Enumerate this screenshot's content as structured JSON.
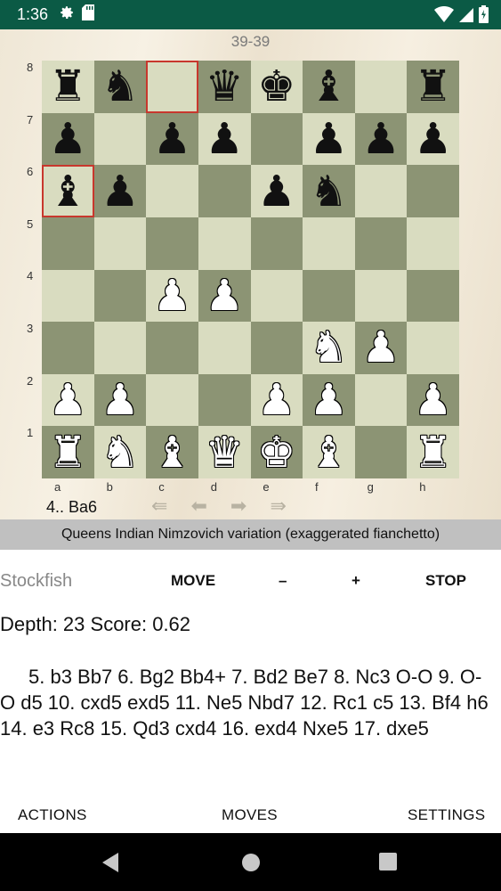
{
  "status_bar": {
    "time": "1:36"
  },
  "board": {
    "move_counter": "39-39",
    "ranks": [
      "8",
      "7",
      "6",
      "5",
      "4",
      "3",
      "2",
      "1"
    ],
    "files": [
      "a",
      "b",
      "c",
      "d",
      "e",
      "f",
      "g",
      "h"
    ],
    "squares": [
      [
        "br",
        "bn",
        "",
        "bq",
        "bk",
        "bb",
        "",
        "br"
      ],
      [
        "bp",
        "",
        "bp",
        "bp",
        "",
        "bp",
        "bp",
        "bp"
      ],
      [
        "bb",
        "bp",
        "",
        "",
        "bp",
        "bn",
        "",
        ""
      ],
      [
        "",
        "",
        "",
        "",
        "",
        "",
        "",
        ""
      ],
      [
        "",
        "",
        "wp",
        "wp",
        "",
        "",
        "",
        ""
      ],
      [
        "",
        "",
        "",
        "",
        "",
        "wn",
        "wp",
        ""
      ],
      [
        "wp",
        "wp",
        "",
        "",
        "wp",
        "wp",
        "",
        "wp"
      ],
      [
        "wr",
        "wn",
        "wb",
        "wq",
        "wk",
        "wb",
        "",
        "wr"
      ]
    ],
    "highlighted": [
      "c8",
      "a6"
    ],
    "last_move": "4.. Ba6"
  },
  "opening_name": "Queens Indian Nimzovich variation (exaggerated fianchetto)",
  "engine": {
    "name": "Stockfish",
    "buttons": [
      "MOVE",
      "–",
      "+",
      "STOP"
    ]
  },
  "analysis": {
    "info": "Depth: 23 Score: 0.62",
    "pv": "5. b3 Bb7 6. Bg2 Bb4+ 7. Bd2 Be7 8. Nc3 O-O 9. O-O d5 10. cxd5 exd5 11. Ne5 Nbd7 12. Rc1 c5 13. Bf4 h6 14. e3 Rc8 15. Qd3 cxd4 16. exd4 Nxe5 17. dxe5"
  },
  "bottom_actions": [
    "ACTIONS",
    "MOVES",
    "SETTINGS"
  ],
  "colors": {
    "status_bar": "#0b5a45",
    "light_square": "#d9dcc0",
    "dark_square": "#8c9474",
    "highlight": "#c8372d",
    "opening_bar": "#c0c0c0"
  }
}
